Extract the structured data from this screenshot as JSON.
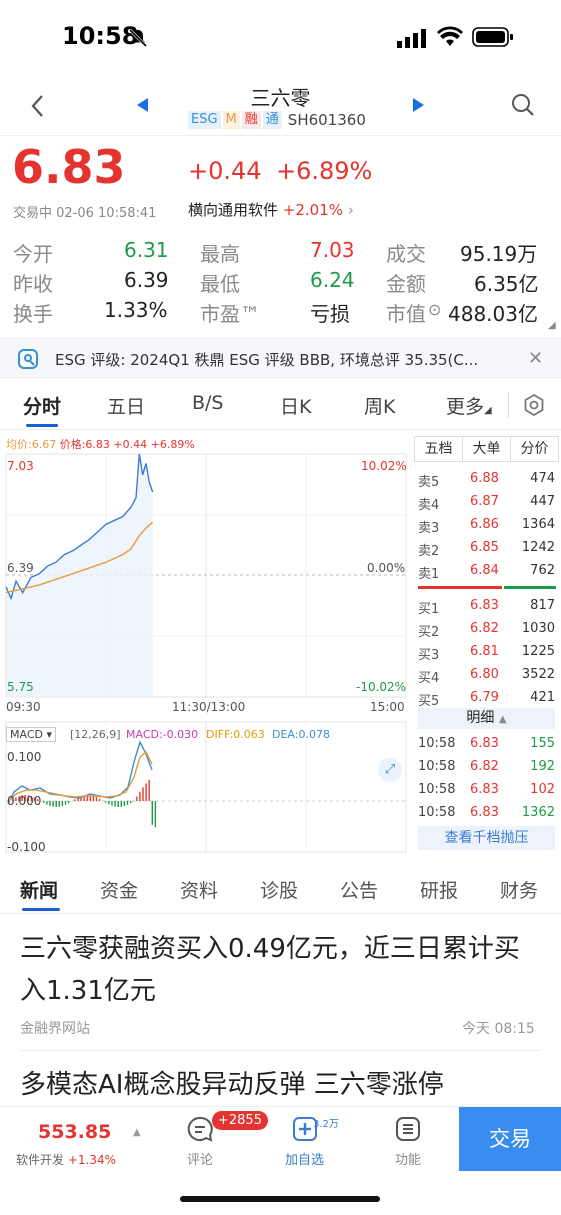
{
  "status_bar": {
    "time": "10:58"
  },
  "header": {
    "title": "三六零",
    "tags": [
      "ESG",
      "M",
      "融",
      "通"
    ],
    "code": "SH601360"
  },
  "quote": {
    "price": "6.83",
    "change": "+0.44",
    "change_pct": "+6.89%",
    "trade_info": "交易中 02-06 10:58:41",
    "sector_name": "横向通用软件",
    "sector_pct": "+2.01%"
  },
  "stats": [
    {
      "label": "今开",
      "value": "6.31",
      "color": "green"
    },
    {
      "label": "最高",
      "value": "7.03",
      "color": "red"
    },
    {
      "label": "成交",
      "value": "95.19万",
      "color": "dark"
    },
    {
      "label": "昨收",
      "value": "6.39",
      "color": "dark"
    },
    {
      "label": "最低",
      "value": "6.24",
      "color": "green"
    },
    {
      "label": "金额",
      "value": "6.35亿",
      "color": "dark"
    },
    {
      "label": "换手",
      "value": "1.33%",
      "color": "dark"
    },
    {
      "label": "市盈™",
      "value": "亏损",
      "color": "dark"
    },
    {
      "label": "市值",
      "value": "488.03亿",
      "color": "dark"
    }
  ],
  "esg_bar": {
    "text": "ESG 评级: 2024Q1 秩鼎 ESG 评级 BBB, 环境总评 35.35(C..."
  },
  "chart_tabs": [
    "分时",
    "五日",
    "B/S",
    "日K",
    "周K",
    "更多"
  ],
  "chart_labels": {
    "avg_legend": "均价:6.67",
    "price_legend": "价格:6.83",
    "chg_legend": "+0.44",
    "pct_legend": "+6.89%",
    "y_top": "7.03",
    "y_mid": "6.39",
    "y_bot": "5.75",
    "pct_top": "10.02%",
    "pct_mid": "0.00%",
    "pct_bot": "-10.02%",
    "t_start": "09:30",
    "t_mid": "11:30/13:00",
    "t_end": "15:00",
    "macd_sel": "MACD",
    "macd_params": "[12,26,9]",
    "macd_val": "MACD:-0.030",
    "diff_val": "DIFF:0.063",
    "dea_val": "DEA:0.078",
    "macd_top": "0.100",
    "macd_zero": "0.000",
    "macd_bot": "-0.100"
  },
  "chart_data": {
    "type": "line",
    "series": [
      {
        "name": "价格",
        "x": [
          "09:30",
          "09:33",
          "09:36",
          "09:40",
          "09:45",
          "09:50",
          "09:55",
          "10:00",
          "10:05",
          "10:10",
          "10:15",
          "10:20",
          "10:25",
          "10:30",
          "10:35",
          "10:40",
          "10:45",
          "10:48",
          "10:50",
          "10:52",
          "10:54",
          "10:56",
          "10:58"
        ],
        "values": [
          6.33,
          6.27,
          6.36,
          6.3,
          6.38,
          6.4,
          6.44,
          6.46,
          6.5,
          6.52,
          6.55,
          6.58,
          6.62,
          6.66,
          6.68,
          6.7,
          6.75,
          6.8,
          7.03,
          6.92,
          6.98,
          6.88,
          6.83
        ]
      },
      {
        "name": "均价",
        "x": [
          "09:30",
          "09:40",
          "09:50",
          "10:00",
          "10:10",
          "10:20",
          "10:30",
          "10:40",
          "10:45",
          "10:50",
          "10:54",
          "10:58"
        ],
        "values": [
          6.3,
          6.32,
          6.34,
          6.37,
          6.4,
          6.43,
          6.46,
          6.5,
          6.53,
          6.6,
          6.64,
          6.67
        ]
      }
    ],
    "ylim": [
      5.75,
      7.03
    ],
    "xlim": [
      "09:30",
      "15:00"
    ]
  },
  "order_book": {
    "tabs": [
      "五档",
      "大单",
      "分价"
    ],
    "asks": [
      {
        "label": "卖5",
        "price": "6.88",
        "vol": "474"
      },
      {
        "label": "卖4",
        "price": "6.87",
        "vol": "447"
      },
      {
        "label": "卖3",
        "price": "6.86",
        "vol": "1364"
      },
      {
        "label": "卖2",
        "price": "6.85",
        "vol": "1242"
      },
      {
        "label": "卖1",
        "price": "6.84",
        "vol": "762"
      }
    ],
    "bids": [
      {
        "label": "买1",
        "price": "6.83",
        "vol": "817"
      },
      {
        "label": "买2",
        "price": "6.82",
        "vol": "1030"
      },
      {
        "label": "买3",
        "price": "6.81",
        "vol": "1225"
      },
      {
        "label": "买4",
        "price": "6.80",
        "vol": "3522"
      },
      {
        "label": "买5",
        "price": "6.79",
        "vol": "421"
      }
    ],
    "detail_label": "明细",
    "ticks": [
      {
        "time": "10:58",
        "price": "6.83",
        "vol": "155",
        "color": "green"
      },
      {
        "time": "10:58",
        "price": "6.82",
        "vol": "192",
        "color": "green"
      },
      {
        "time": "10:58",
        "price": "6.83",
        "vol": "102",
        "color": "red"
      },
      {
        "time": "10:58",
        "price": "6.83",
        "vol": "1362",
        "color": "green"
      }
    ],
    "more_label": "查看千档抛压"
  },
  "news_tabs": [
    "新闻",
    "资金",
    "资料",
    "诊股",
    "公告",
    "研报",
    "财务"
  ],
  "news": [
    {
      "title": "三六零获融资买入0.49亿元，近三日累计买入1.31亿元",
      "source": "金融界网站",
      "time": "今天 08:15"
    },
    {
      "title": "多模态AI概念股异动反弹 三六零涨停"
    }
  ],
  "bottom_bar": {
    "index_value": "553.85",
    "index_name": "软件开发",
    "index_pct": "+1.34%",
    "comment_label": "评论",
    "comment_badge": "+2855",
    "watch_label": "加自选",
    "watch_count": "3.2万",
    "func_label": "功能",
    "trade_label": "交易"
  },
  "colors": {
    "red": "#e5342f",
    "green": "#1f9a4a",
    "blue": "#1a5fd6",
    "trade_button": "#3a8df0"
  }
}
